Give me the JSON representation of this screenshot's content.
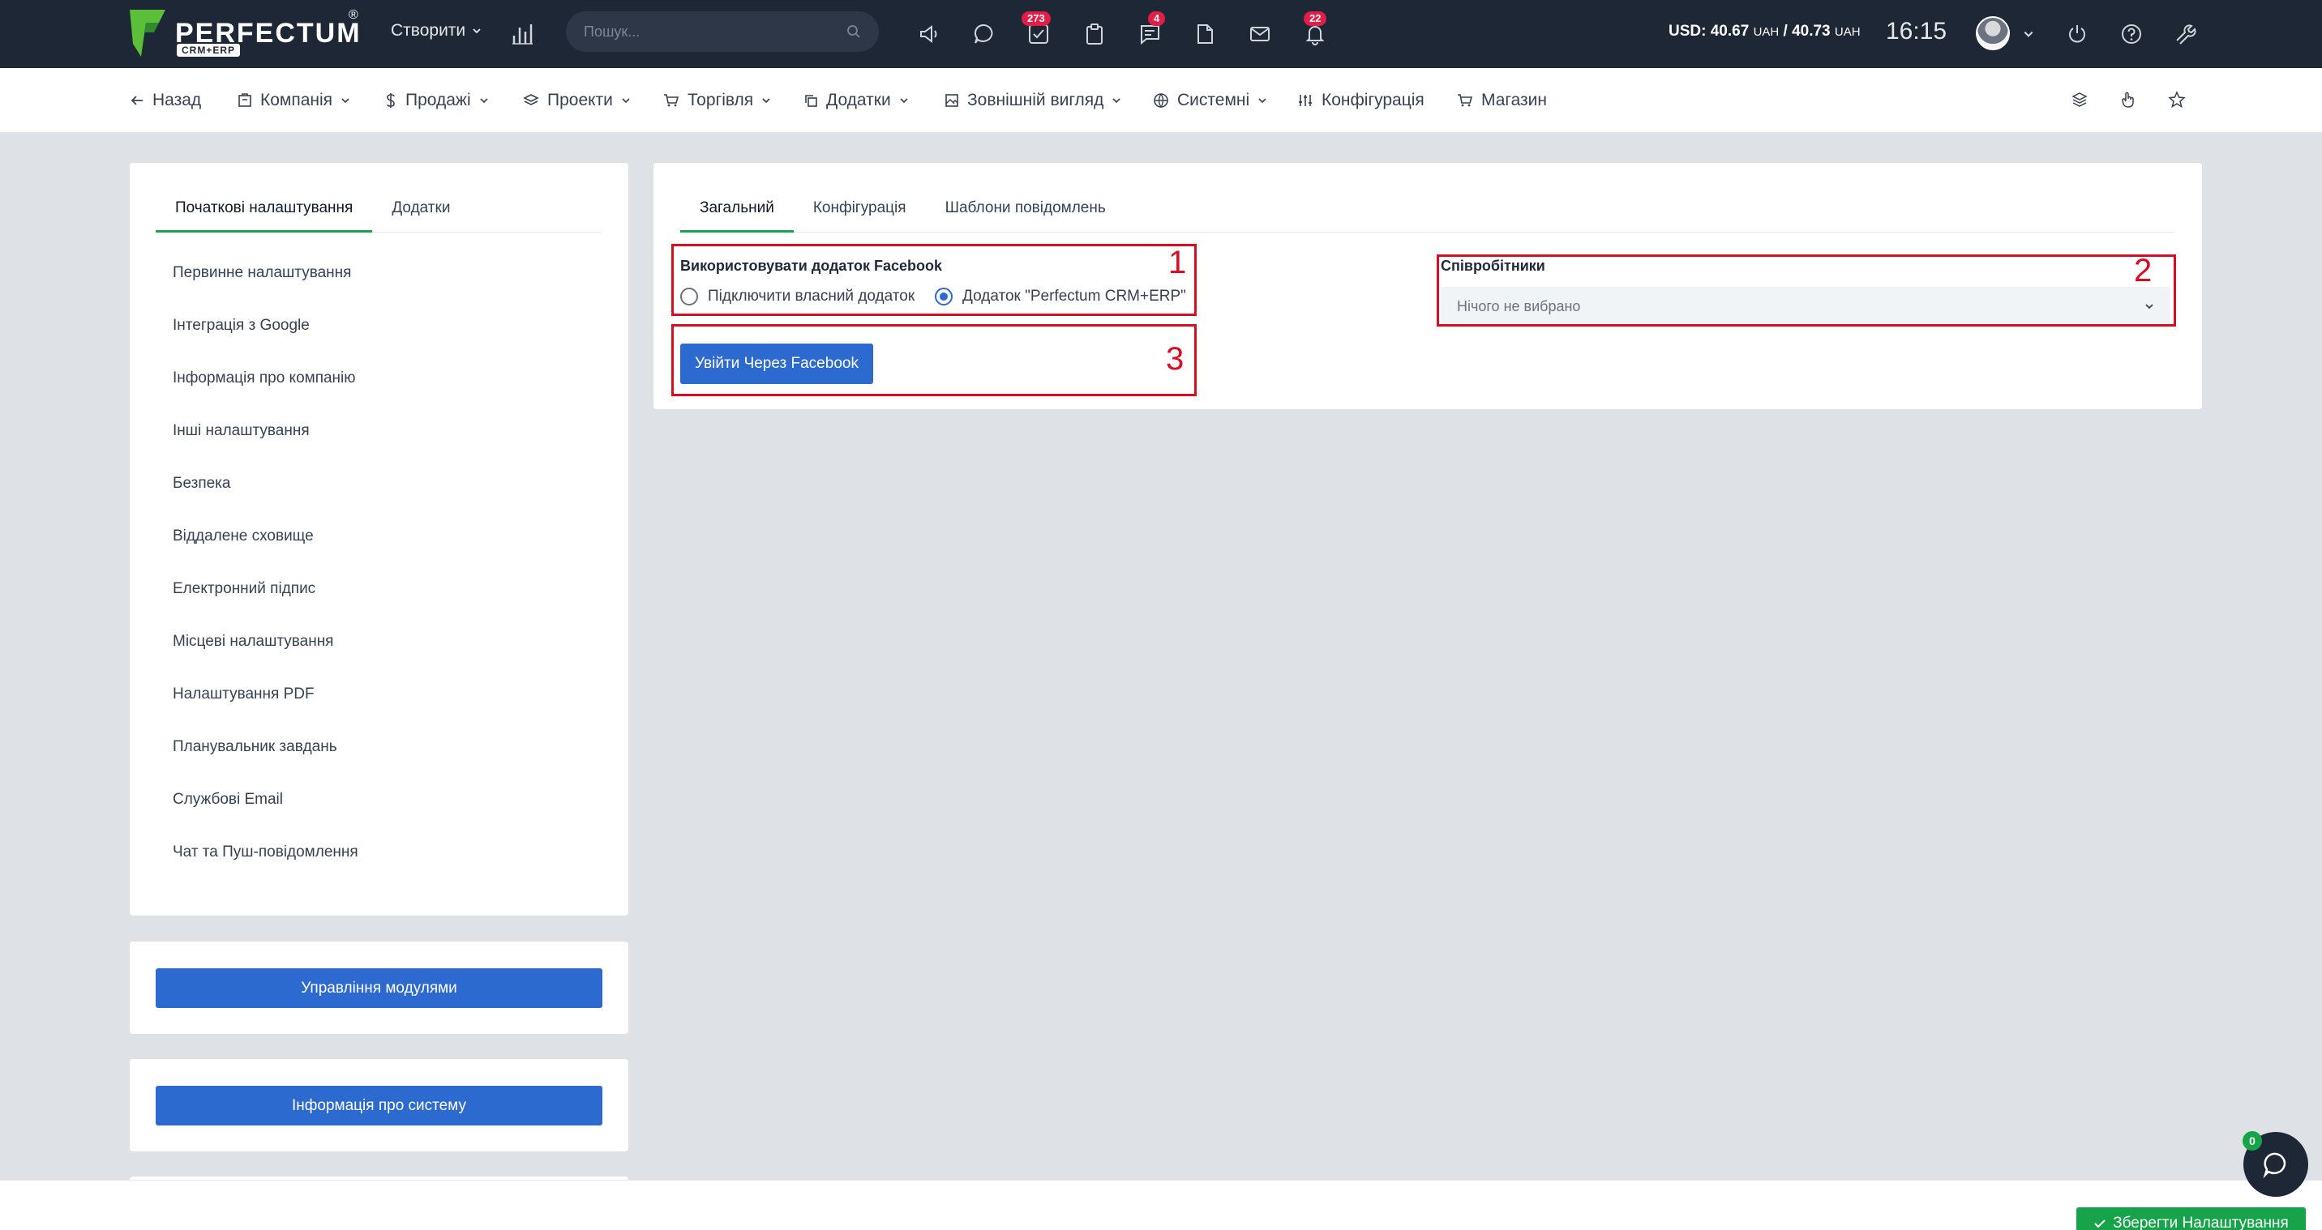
{
  "topbar": {
    "logo_text": "PERFECTUM",
    "logo_sub": "CRM+ERP",
    "logo_reg": "®",
    "create_label": "Створити",
    "search_placeholder": "Пошук...",
    "badges": {
      "tasks": "273",
      "chat": "4",
      "notifications": "22"
    },
    "currency": {
      "usd": "USD: 40.67",
      "unit1": "UAH",
      "sep": " / 40.73",
      "unit2": "UAH"
    },
    "clock": "16:15"
  },
  "nav": {
    "back": "Назад",
    "company": "Компанія",
    "sales": "Продажі",
    "projects": "Проекти",
    "trade": "Торгівля",
    "addons": "Додатки",
    "appearance": "Зовнішній вигляд",
    "system": "Системні",
    "config": "Конфігурація",
    "shop": "Магазин"
  },
  "sidebar": {
    "tabs": [
      "Початкові налаштування",
      "Додатки"
    ],
    "items": [
      "Первинне налаштування",
      "Інтеграція з Google",
      "Інформація про компанію",
      "Інші налаштування",
      "Безпека",
      "Віддалене сховище",
      "Електронний підпис",
      "Місцеві налаштування",
      "Налаштування PDF",
      "Планувальник завдань",
      "Службові Email",
      "Чат та Пуш-повідомлення"
    ],
    "modules_button": "Управління модулями",
    "sysinfo_button": "Інформація про систему"
  },
  "main": {
    "tabs": [
      "Загальний",
      "Конфігурація",
      "Шаблони повідомлень"
    ],
    "use_app_label": "Використовувати додаток Facebook",
    "radio_own": "Підключити власний додаток",
    "radio_perfectum": "Додаток \"Perfectum CRM+ERP\"",
    "fb_login_button": "Увійти Через Facebook",
    "employees_label": "Співробітники",
    "employees_placeholder": "Нічого не вибрано",
    "annotations": [
      "1",
      "2",
      "3"
    ]
  },
  "footer": {
    "save_button": "Зберегти Налаштування",
    "chat_count": "0"
  },
  "colors": {
    "accent": "#2d6acf",
    "success": "#16a34a",
    "annotation": "#d90d1f",
    "topbar": "#1e2735"
  }
}
